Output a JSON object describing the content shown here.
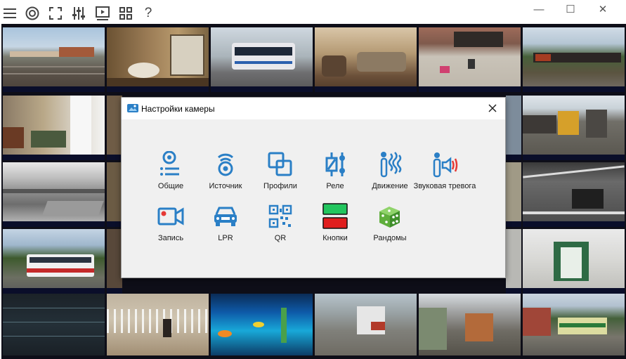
{
  "colors": {
    "accent_blue": "#2a7fc6",
    "accent_red": "#e53935",
    "green": "#22c55e",
    "red_button": "#e01e1e"
  },
  "toolbar": {
    "icons": [
      "menu-icon",
      "camera-target-icon",
      "fullscreen-icon",
      "equalizer-icon",
      "playback-icon",
      "grid-icon",
      "help-icon"
    ],
    "help_label": "?"
  },
  "window": {
    "minimize": "—",
    "maximize": "☐",
    "close": "✕"
  },
  "dialog": {
    "title": "Настройки камеры",
    "close": "✕",
    "tiles": [
      {
        "id": "general",
        "label": "Общие",
        "icon": "general-settings-icon"
      },
      {
        "id": "source",
        "label": "Источник",
        "icon": "source-icon"
      },
      {
        "id": "profiles",
        "label": "Профили",
        "icon": "profiles-icon"
      },
      {
        "id": "relay",
        "label": "Реле",
        "icon": "relay-icon"
      },
      {
        "id": "motion",
        "label": "Движение",
        "icon": "motion-icon"
      },
      {
        "id": "sound",
        "label": "Звуковая тревога",
        "icon": "sound-alarm-icon"
      },
      {
        "id": "record",
        "label": "Запись",
        "icon": "record-icon"
      },
      {
        "id": "lpr",
        "label": "LPR",
        "icon": "lpr-car-icon"
      },
      {
        "id": "qr",
        "label": "QR",
        "icon": "qr-icon"
      },
      {
        "id": "buttons",
        "label": "Кнопки",
        "icon": "buttons-icon"
      },
      {
        "id": "random",
        "label": "Рандомы",
        "icon": "dice-icon"
      }
    ]
  },
  "camera_grid": {
    "columns": 6,
    "rows": 5,
    "tiles": [
      {
        "scene": "rail-yard-sky"
      },
      {
        "scene": "bathroom-interior"
      },
      {
        "scene": "street-bus"
      },
      {
        "scene": "living-room"
      },
      {
        "scene": "courtyard-patio"
      },
      {
        "scene": "freight-train"
      },
      {
        "scene": "bedroom-interior"
      },
      {
        "scene": "hidden"
      },
      {
        "scene": "hidden"
      },
      {
        "scene": "hidden"
      },
      {
        "scene": "hidden"
      },
      {
        "scene": "rail-yard-locomotive"
      },
      {
        "scene": "harbor-grayscale"
      },
      {
        "scene": "hidden"
      },
      {
        "scene": "hidden"
      },
      {
        "scene": "hidden"
      },
      {
        "scene": "hidden"
      },
      {
        "scene": "crossing-grayscale"
      },
      {
        "scene": "street-bus-trees"
      },
      {
        "scene": "hidden"
      },
      {
        "scene": "hidden"
      },
      {
        "scene": "hidden"
      },
      {
        "scene": "hidden"
      },
      {
        "scene": "corridor-door"
      },
      {
        "scene": "dark-fence-night"
      },
      {
        "scene": "gate-fence"
      },
      {
        "scene": "aquarium"
      },
      {
        "scene": "road-truck"
      },
      {
        "scene": "road-truck-2"
      },
      {
        "scene": "train-platform"
      }
    ]
  }
}
